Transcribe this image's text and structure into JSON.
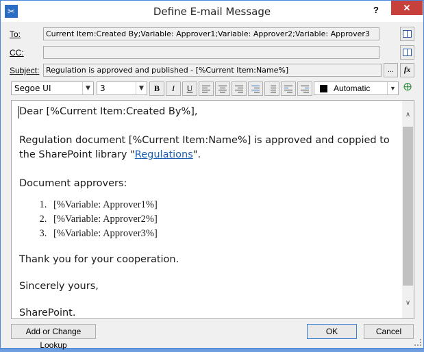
{
  "window": {
    "title": "Define E-mail Message",
    "help_label": "?",
    "close_label": "✕"
  },
  "fields": {
    "to": {
      "label": "To:",
      "value": "Current Item:Created By;Variable: Approver1;Variable: Approver2;Variable: Approver3"
    },
    "cc": {
      "label": "CC:",
      "value": ""
    },
    "subject": {
      "label": "Subject:",
      "value": "Regulation is approved and published - [%Current Item:Name%]"
    },
    "ellipsis_label": "...",
    "fx_label": "fx"
  },
  "toolbar": {
    "font_name": "Segoe UI",
    "font_size": "3",
    "bold": "B",
    "italic": "I",
    "underline": "U",
    "color_name": "Automatic",
    "color_value": "#000000"
  },
  "message": {
    "greeting": "Dear [%Current Item:Created By%],",
    "para1_before": "Regulation document [%Current Item:Name%] is approved and coppied to the SharePoint library \"",
    "para1_link": "Regulations",
    "para1_after": "\".",
    "approvers_heading": "Document approvers:",
    "approvers": [
      "[%Variable: Approver1%]",
      "[%Variable: Approver2%]",
      "[%Variable: Approver3%]"
    ],
    "thanks": "Thank you for your cooperation.",
    "closing": "Sincerely yours,",
    "signature": "SharePoint."
  },
  "buttons": {
    "lookup": "Add or Change Lookup",
    "ok": "OK",
    "cancel": "Cancel"
  },
  "icons": {
    "app": "tools-icon",
    "address_book": "address-book-icon",
    "check_names": "check-names-icon"
  }
}
